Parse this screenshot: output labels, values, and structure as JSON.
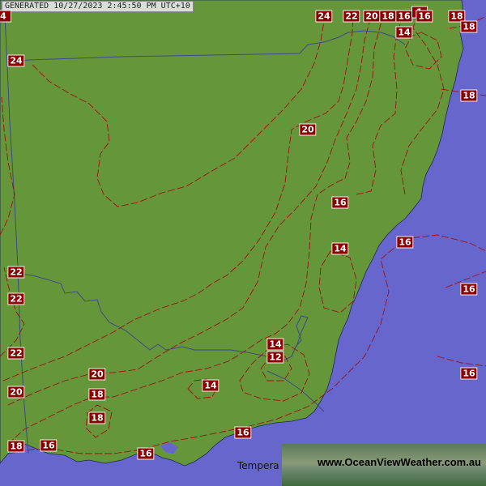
{
  "generated": "GENERATED 10/27/2023 2:45:50 PM UTC+10",
  "legend_word": "Tempera",
  "brand": "www.OceanViewWeather.com.au",
  "colors": {
    "land": "#66963a",
    "ocean": "#6666cc",
    "contour": "#a01010",
    "border": "#3c4a8a",
    "label_bg": "#8b0000"
  },
  "contour_labels": [
    "4",
    "24",
    "22",
    "20",
    "18",
    "16",
    "1",
    "16",
    "18",
    "14",
    "24",
    "20",
    "16",
    "14",
    "18",
    "16",
    "22",
    "22",
    "22",
    "14",
    "12",
    "20",
    "18",
    "14",
    "18",
    "16",
    "20",
    "16",
    "18",
    "16",
    "18",
    "16",
    "16"
  ]
}
